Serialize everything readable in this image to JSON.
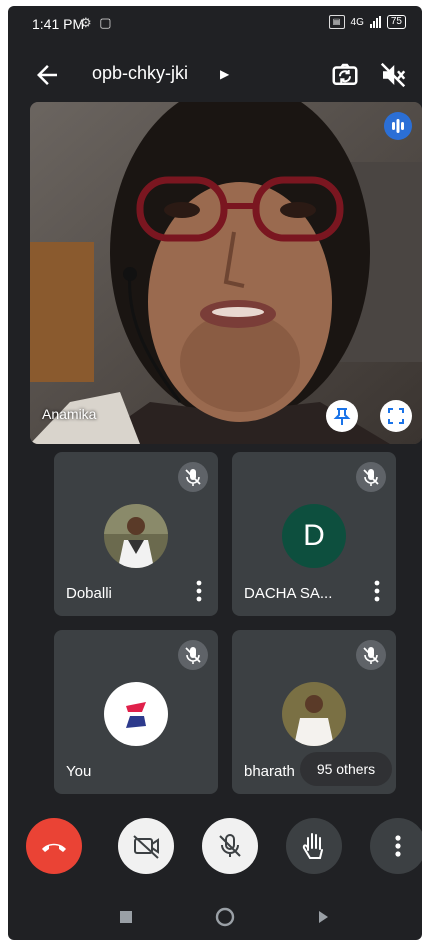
{
  "status_bar": {
    "time": "1:41 PM",
    "network": "4G",
    "battery": "75"
  },
  "meeting": {
    "title": "opb-chky-jki"
  },
  "main_speaker": {
    "name": "Anamika"
  },
  "participants": [
    {
      "name": "Doballi"
    },
    {
      "name": "DACHA SA...",
      "initial": "D"
    },
    {
      "name": "You"
    },
    {
      "name": "bharath"
    }
  ],
  "others_label": "95 others",
  "colors": {
    "background": "#202124",
    "tile": "#3c4043",
    "end_call": "#ea4335",
    "speaking_badge": "#2b6fd6",
    "avatar_d": "#0d4f3e"
  },
  "icons": [
    "back-arrow-icon",
    "switch-camera-icon",
    "volume-off-icon",
    "speaking-icon",
    "pin-icon",
    "fullscreen-icon",
    "mic-off-icon",
    "more-vert-icon",
    "end-call-icon",
    "camera-off-icon",
    "raise-hand-icon"
  ]
}
